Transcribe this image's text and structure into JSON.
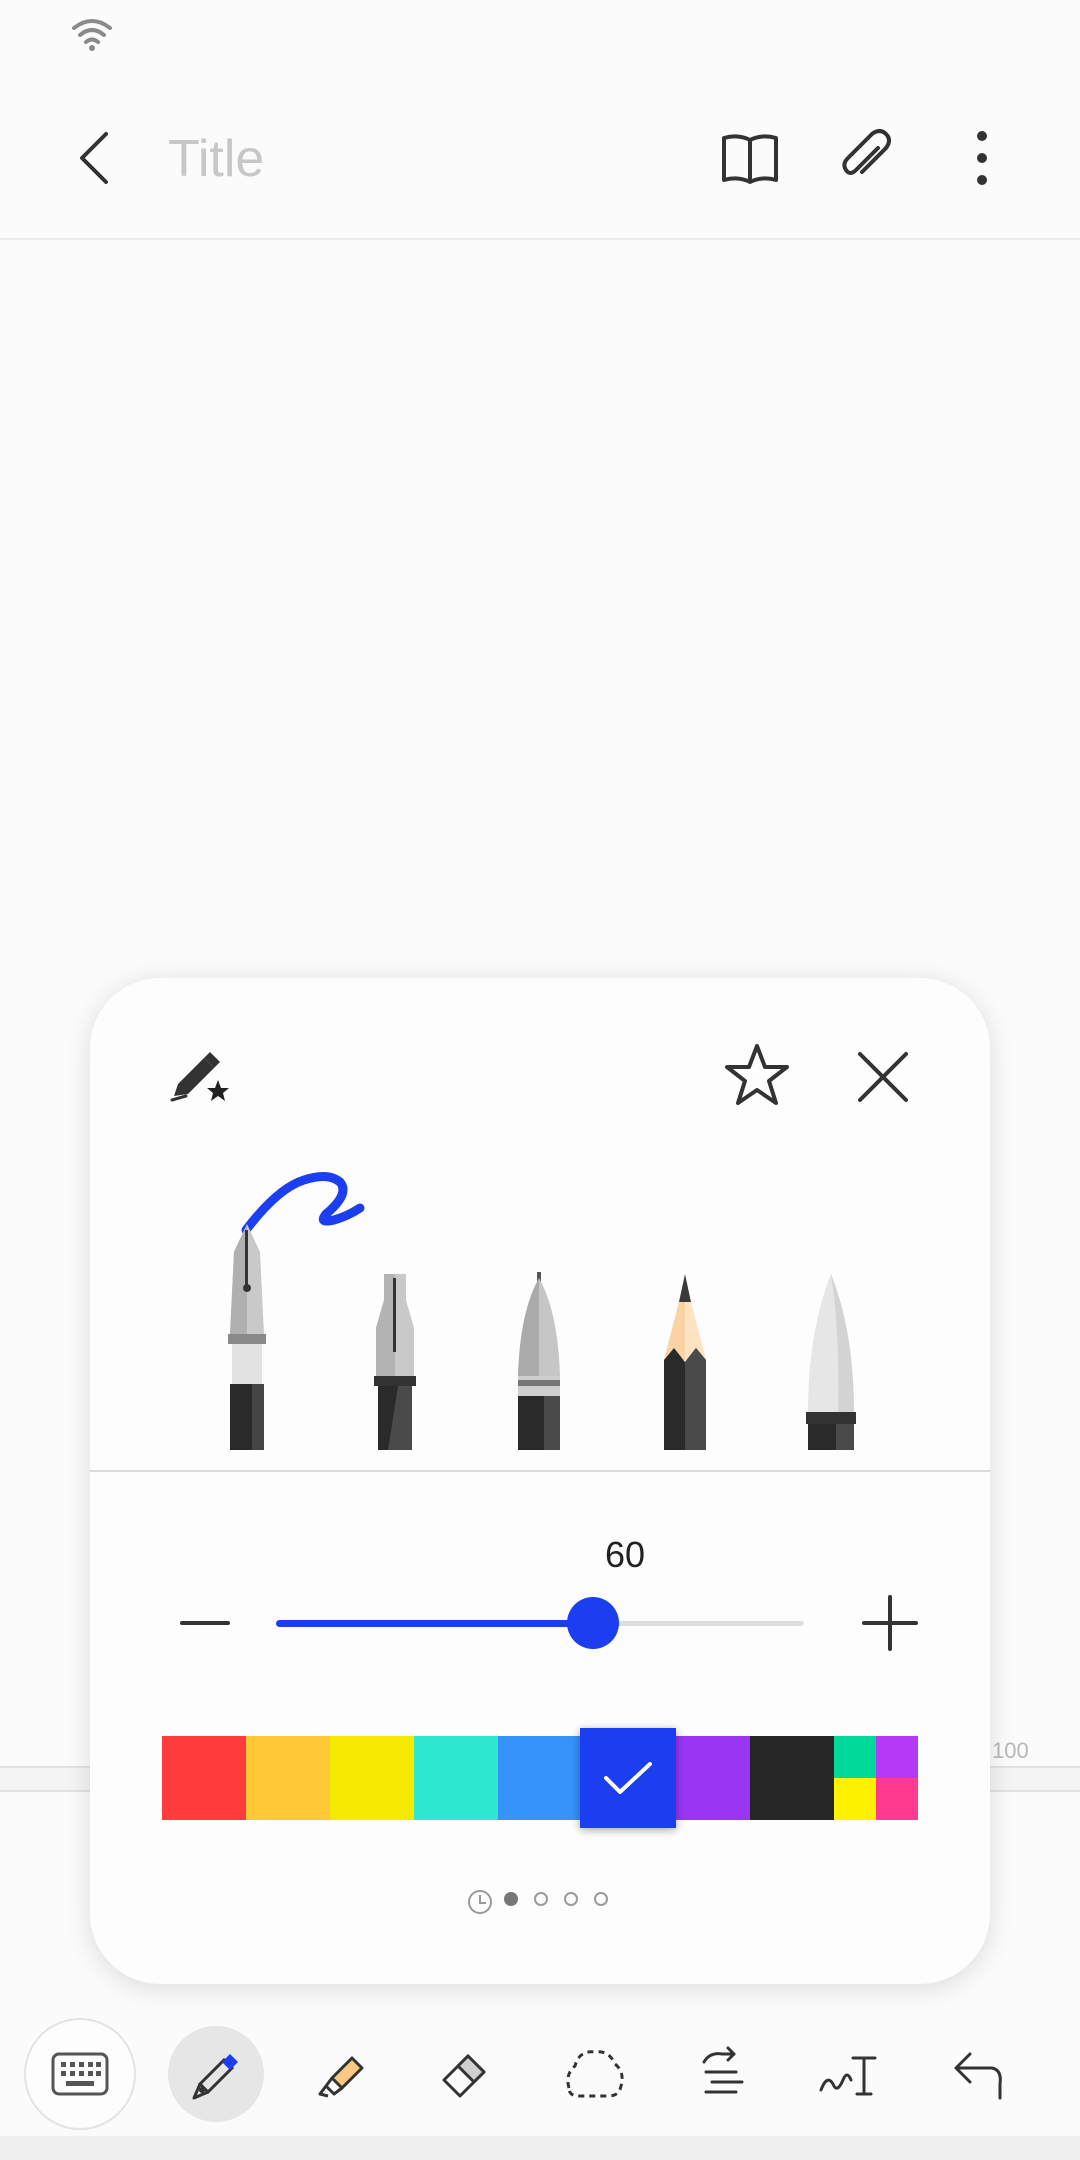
{
  "header": {
    "title_placeholder": "Title"
  },
  "note": {
    "page_number": "100"
  },
  "pen_panel": {
    "size_value": "60",
    "size_level": 0.6,
    "pens": [
      "fountain-pen",
      "calligraphy-pen",
      "brush-pen",
      "pencil",
      "marker"
    ],
    "selected_pen": "fountain-pen",
    "colors": [
      "#ff3b3b",
      "#ffc935",
      "#f6e900",
      "#2ee8d2",
      "#3693f9",
      "#1b3ef0",
      "#9a36f3",
      "#262626"
    ],
    "selected_color": "#1b3ef0",
    "more_colors": [
      "#00d99a",
      "#b53af5",
      "#fff200",
      "#ff3a8f"
    ],
    "pages": 4,
    "active_page": 1
  },
  "toolbar": {
    "items": [
      "keyboard-icon",
      "pen-icon",
      "highlighter-icon",
      "eraser-icon",
      "lasso-icon",
      "text-select-icon",
      "handwriting-to-text-icon",
      "undo-icon"
    ],
    "active": "pen-icon"
  },
  "colors": {
    "accent": "#1b3ef0"
  }
}
